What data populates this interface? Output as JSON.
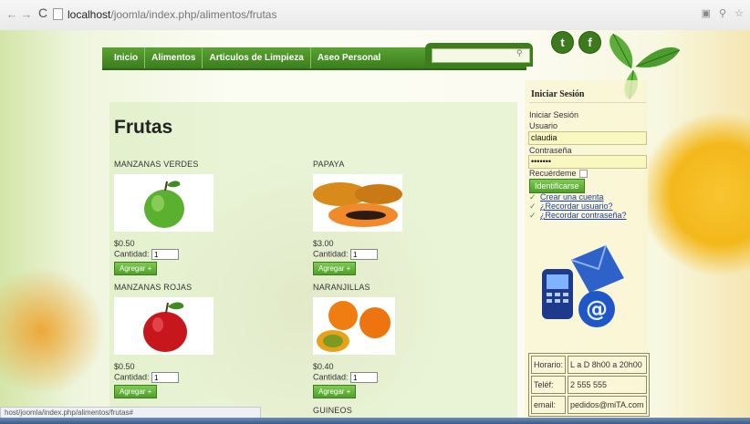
{
  "browser": {
    "url_host": "localhost",
    "url_path": "/joomla/index.php/alimentos/frutas",
    "status_text": "host/joomla/index.php/alimentos/frutas#"
  },
  "nav": {
    "items": [
      "Inicio",
      "Alimentos",
      "Articulos de Limpieza",
      "Aseo Personal"
    ]
  },
  "social": {
    "twitter": "t",
    "facebook": "f"
  },
  "page": {
    "title": "Frutas"
  },
  "products": [
    {
      "name": "MANZANAS VERDES",
      "price": "$0.50",
      "qty_label": "Cantidad:",
      "qty": "1",
      "button": "Agregar +",
      "image": "green-apple"
    },
    {
      "name": "PAPAYA",
      "price": "$3.00",
      "qty_label": "Cantidad:",
      "qty": "1",
      "button": "Agregar +",
      "image": "papaya"
    },
    {
      "name": "MANZANAS ROJAS",
      "price": "$0.50",
      "qty_label": "Cantidad:",
      "qty": "1",
      "button": "Agregar +",
      "image": "red-apple"
    },
    {
      "name": "NARANJILLAS",
      "price": "$0.40",
      "qty_label": "Cantidad:",
      "qty": "1",
      "button": "Agregar +",
      "image": "naranjilla"
    },
    {
      "name": "GUINEOS"
    }
  ],
  "sidebar": {
    "heading": "Iniciar Sesión",
    "subheading": "Iniciar Sesión",
    "user_label": "Usuario",
    "user_value": "claudia",
    "pass_label": "Contraseña",
    "pass_value": "•••••••",
    "remember_label": "Recuérdeme",
    "login_button": "Identificarse",
    "links": [
      "Crear una cuenta",
      "¿Recordar usuario?",
      "¿Recordar contraseña?"
    ],
    "info": [
      {
        "k": "Horario:",
        "v": "L a D 8h00 a 20h00"
      },
      {
        "k": "Teléf:",
        "v": "2 555 555"
      },
      {
        "k": "email:",
        "v": "pedidos@miTA.com"
      }
    ]
  },
  "colors": {
    "nav_green": "#3b7d1e",
    "button_green": "#5fae35",
    "link_blue": "#1b3fa8"
  }
}
